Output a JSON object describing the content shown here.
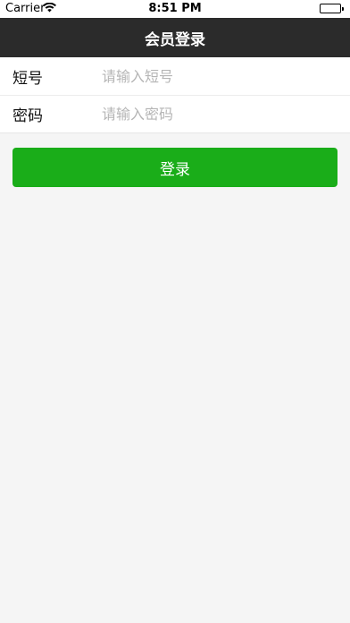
{
  "status_bar": {
    "carrier": "Carrier",
    "time": "8:51 PM"
  },
  "nav": {
    "title": "会员登录"
  },
  "form": {
    "phone": {
      "label": "短号",
      "placeholder": "请输入短号",
      "value": ""
    },
    "password": {
      "label": "密码",
      "placeholder": "请输入密码",
      "value": ""
    }
  },
  "login_button": {
    "label": "登录"
  },
  "colors": {
    "nav_bg": "#2b2b2b",
    "primary": "#1aad19",
    "background": "#f5f5f5"
  }
}
